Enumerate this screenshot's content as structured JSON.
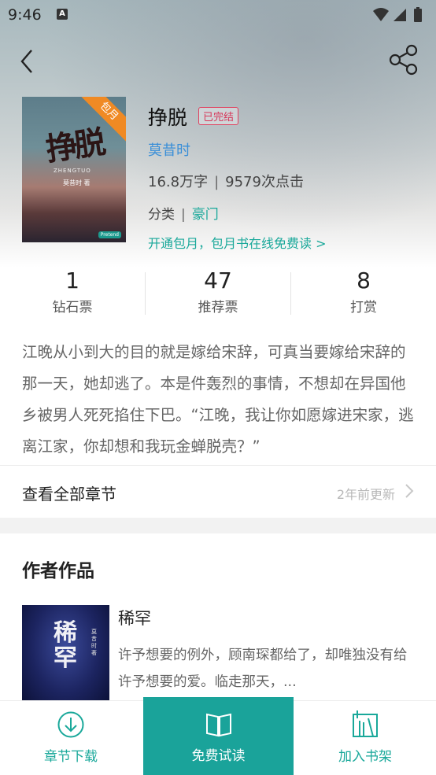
{
  "status_bar": {
    "time": "9:46",
    "indicator": "A"
  },
  "nav": {
    "back_icon": "back-arrow-icon",
    "share_icon": "share-icon"
  },
  "book": {
    "cover": {
      "title_art": "挣脱",
      "subtitle_art": "ZHENGTUO",
      "author_art": "莫昔时 著",
      "publisher_art": "Pretend",
      "ribbon": "包月"
    },
    "title": "挣脱",
    "status_badge": "已完结",
    "author": "莫昔时",
    "word_count": "16.8万字",
    "clicks": "9579次点击",
    "category_label": "分类",
    "category": "豪门",
    "promo": "开通包月，包月书在线免费读 >"
  },
  "counters": [
    {
      "value": "1",
      "label": "钻石票"
    },
    {
      "value": "47",
      "label": "推荐票"
    },
    {
      "value": "8",
      "label": "打赏"
    }
  ],
  "description": "江晚从小到大的目的就是嫁给宋辞，可真当要嫁给宋辞的那一天，她却逃了。本是件轰烈的事情，不想却在异国他乡被男人死死掐住下巴。“江晚，我让你如愿嫁进宋家，逃离江家，你却想和我玩金蝉脱壳？”",
  "chapters": {
    "label": "查看全部章节",
    "updated": "2年前更新"
  },
  "author_works": {
    "heading": "作者作品",
    "items": [
      {
        "title": "稀罕",
        "cover_art": "稀罕",
        "cover_author": "莫昔时著",
        "desc": "许予想要的例外，顾南琛都给了，却唯独没有给许予想要的爱。临走那天，..."
      }
    ]
  },
  "bottom_bar": {
    "download": "章节下载",
    "free_read": "免费试读",
    "add_shelf": "加入书架"
  },
  "colors": {
    "accent": "#19a89a",
    "author_link": "#3a8fd8",
    "badge": "#d63658",
    "ribbon": "#f08a24"
  }
}
